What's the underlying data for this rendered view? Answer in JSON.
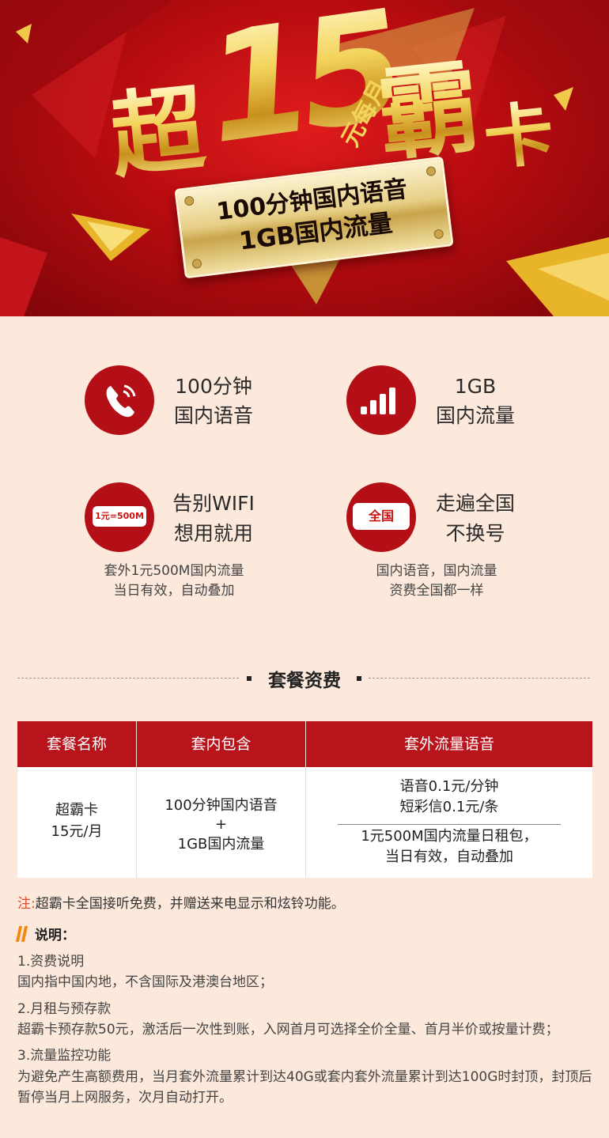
{
  "banner": {
    "title_chao": "超",
    "title_15": "15",
    "title_ba": "霸",
    "title_ka": "卡",
    "per_month": "元每月",
    "plate_line1": "100分钟国内语音",
    "plate_line2": "1GB国内流量"
  },
  "features": {
    "voice": {
      "icon": "phone-icon",
      "line1": "100分钟",
      "line2": "国内语音"
    },
    "data": {
      "icon": "signal-bars-icon",
      "line1": "1GB",
      "line2": "国内流量"
    },
    "wifi": {
      "icon_label": "1元=500M",
      "line1": "告别WIFI",
      "line2": "想用就用",
      "desc1": "套外1元500M国内流量",
      "desc2": "当日有效，自动叠加"
    },
    "national": {
      "icon_label": "全国",
      "line1": "走遍全国",
      "line2": "不换号",
      "desc1": "国内语音，国内流量",
      "desc2": "资费全国都一样"
    }
  },
  "section_title": "套餐资费",
  "table": {
    "headers": [
      "套餐名称",
      "套内包含",
      "套外流量语音"
    ],
    "row": {
      "name_line1": "超霸卡",
      "name_line2": "15元/月",
      "include_line1": "100分钟国内语音",
      "include_plus": "+",
      "include_line2": "1GB国内流量",
      "extra_line1": "语音0.1元/分钟",
      "extra_line2": "短彩信0.1元/条",
      "extra_line3": "1元500M国内流量日租包，",
      "extra_line4": "当日有效，自动叠加"
    }
  },
  "note": {
    "prefix": "注:",
    "text": "超霸卡全国接听免费，并赠送来电显示和炫铃功能。"
  },
  "explanation": {
    "title": "说明：",
    "items": [
      {
        "heading": "1.资费说明",
        "body": "国内指中国内地，不含国际及港澳台地区；"
      },
      {
        "heading": "2.月租与预存款",
        "body": "超霸卡预存款50元，激活后一次性到账，入网首月可选择全价全量、首月半价或按量计费；"
      },
      {
        "heading": "3.流量监控功能",
        "body": "为避免产生高额费用，当月套外流量累计到达40G或套内套外流量累计到达100G时封顶，封顶后暂停当月上网服务，次月自动打开。"
      }
    ]
  },
  "colors": {
    "accent_red": "#b8141c",
    "page_bg": "#fde9dc",
    "note_red": "#e8482c",
    "orange": "#f08a14"
  }
}
